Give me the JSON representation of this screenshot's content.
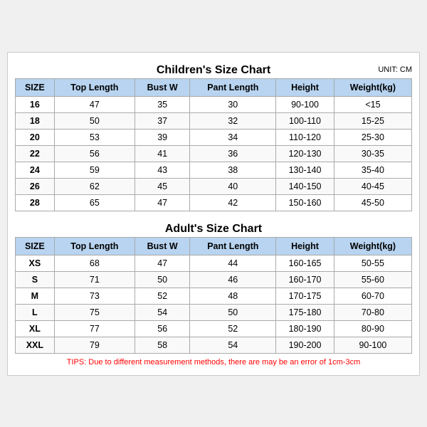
{
  "children_chart": {
    "title": "Children's Size Chart",
    "unit": "UNIT: CM",
    "headers": [
      "SIZE",
      "Top Length",
      "Bust W",
      "Pant Length",
      "Height",
      "Weight(kg)"
    ],
    "rows": [
      [
        "16",
        "47",
        "35",
        "30",
        "90-100",
        "<15"
      ],
      [
        "18",
        "50",
        "37",
        "32",
        "100-110",
        "15-25"
      ],
      [
        "20",
        "53",
        "39",
        "34",
        "110-120",
        "25-30"
      ],
      [
        "22",
        "56",
        "41",
        "36",
        "120-130",
        "30-35"
      ],
      [
        "24",
        "59",
        "43",
        "38",
        "130-140",
        "35-40"
      ],
      [
        "26",
        "62",
        "45",
        "40",
        "140-150",
        "40-45"
      ],
      [
        "28",
        "65",
        "47",
        "42",
        "150-160",
        "45-50"
      ]
    ]
  },
  "adults_chart": {
    "title": "Adult's Size Chart",
    "headers": [
      "SIZE",
      "Top Length",
      "Bust W",
      "Pant Length",
      "Height",
      "Weight(kg)"
    ],
    "rows": [
      [
        "XS",
        "68",
        "47",
        "44",
        "160-165",
        "50-55"
      ],
      [
        "S",
        "71",
        "50",
        "46",
        "160-170",
        "55-60"
      ],
      [
        "M",
        "73",
        "52",
        "48",
        "170-175",
        "60-70"
      ],
      [
        "L",
        "75",
        "54",
        "50",
        "175-180",
        "70-80"
      ],
      [
        "XL",
        "77",
        "56",
        "52",
        "180-190",
        "80-90"
      ],
      [
        "XXL",
        "79",
        "58",
        "54",
        "190-200",
        "90-100"
      ]
    ]
  },
  "tips": "TIPS: Due to different measurement methods, there are may be an error of 1cm-3cm"
}
